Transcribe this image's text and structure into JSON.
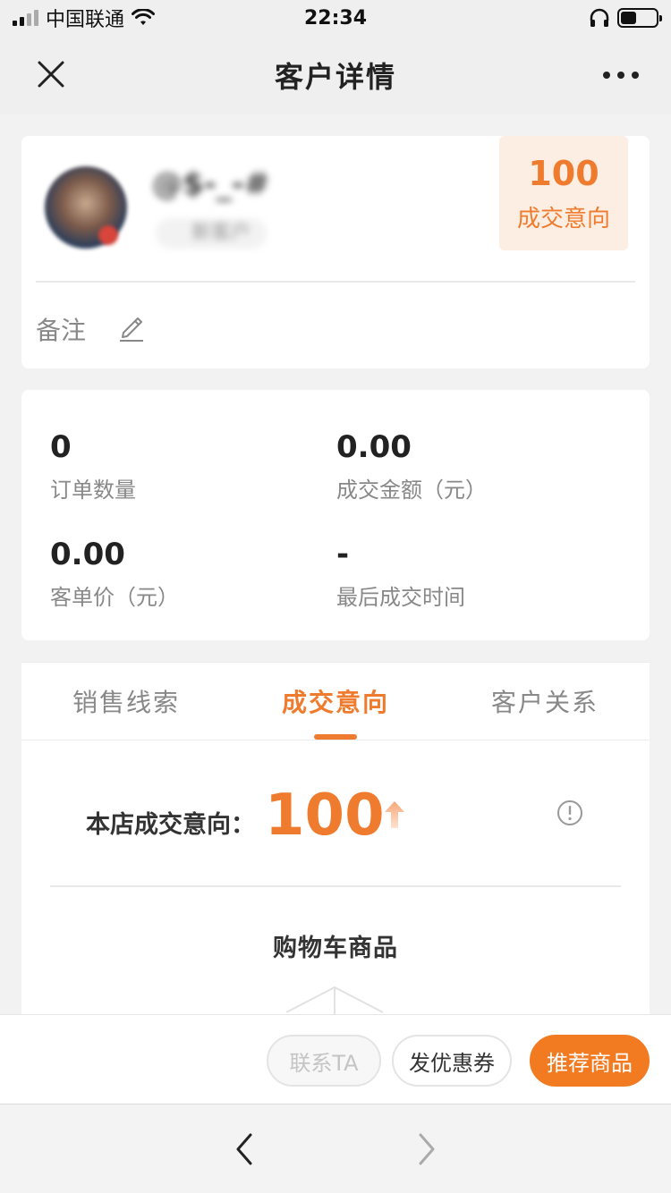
{
  "status_bar": {
    "carrier": "中国联通",
    "time": "22:34",
    "battery_percent": 45,
    "signal_bars_filled": 2,
    "signal_bars_total": 4,
    "icons": [
      "signal-icon",
      "wifi-icon",
      "headphones-icon",
      "battery-icon"
    ]
  },
  "nav": {
    "title": "客户详情",
    "close_icon": "close-icon",
    "more_icon": "more-icon"
  },
  "profile": {
    "name": "@$-_-#",
    "tag": "新客户",
    "intent_score": "100",
    "intent_label": "成交意向",
    "remark_label": "备注",
    "remark_icon": "edit-icon"
  },
  "stats": [
    {
      "value": "0",
      "label": "订单数量"
    },
    {
      "value": "0.00",
      "label": "成交金额（元）"
    },
    {
      "value": "0.00",
      "label": "客单价（元）"
    },
    {
      "value": "-",
      "label": "最后成交时间"
    }
  ],
  "tabs": [
    {
      "label": "销售线索",
      "active": false
    },
    {
      "label": "成交意向",
      "active": true
    },
    {
      "label": "客户关系",
      "active": false
    }
  ],
  "intent_panel": {
    "label": "本店成交意向：",
    "value": "100",
    "trend_icon": "up-arrow-icon",
    "info_icon": "info-icon",
    "cart_title": "购物车商品"
  },
  "actions": {
    "contact": "联系TA",
    "coupon": "发优惠券",
    "recommend": "推荐商品"
  },
  "colors": {
    "accent": "#ef7c2e",
    "accent_bg": "#fdeee3",
    "primary_button": "#f27a21"
  }
}
